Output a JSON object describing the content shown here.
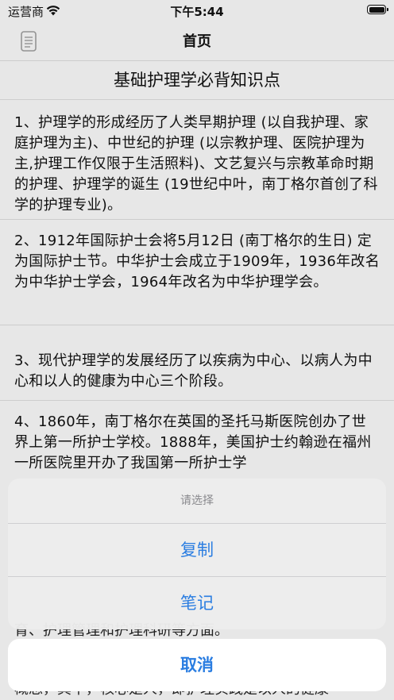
{
  "status_bar": {
    "carrier": "运营商",
    "time": "下午5:44"
  },
  "nav": {
    "title": "首页",
    "left_icon": "document-icon"
  },
  "article": {
    "title": "基础护理学必背知识点",
    "paragraphs": [
      "1、护理学的形成经历了人类早期护理 (以自我护理、家庭护理为主)、中世纪的护理 (以宗教护理、医院护理为主,护理工作仅限于生活照料)、文艺复兴与宗教革命时期的护理、护理学的诞生 (19世纪中叶，南丁格尔首创了科学的护理专业)。",
      "2、1912年国际护士会将5月12日 (南丁格尔的生日) 定为国际护士节。中华护士会成立于1909年，1936年改名为中华护士学会，1964年改名为中华护理学会。",
      "3、现代护理学的发展经历了以疾病为中心、以病人为中心和以人的健康为中心三个阶段。",
      "4、1860年，南丁格尔在英国的圣托马斯医院创办了世界上第一所护士学校。1888年，美国护士约翰逊在福州一所医院里开办了我国第一所护士学"
    ],
    "obscured_line_1": "育、护理管理和护理科研等方面。",
    "obscured_line_2": "概念，其中，核心是人，即护理实践是以人的健康"
  },
  "action_sheet": {
    "header": "请选择",
    "actions": [
      "复制",
      "笔记"
    ],
    "cancel": "取消",
    "accent_color": "#2a7de1"
  }
}
